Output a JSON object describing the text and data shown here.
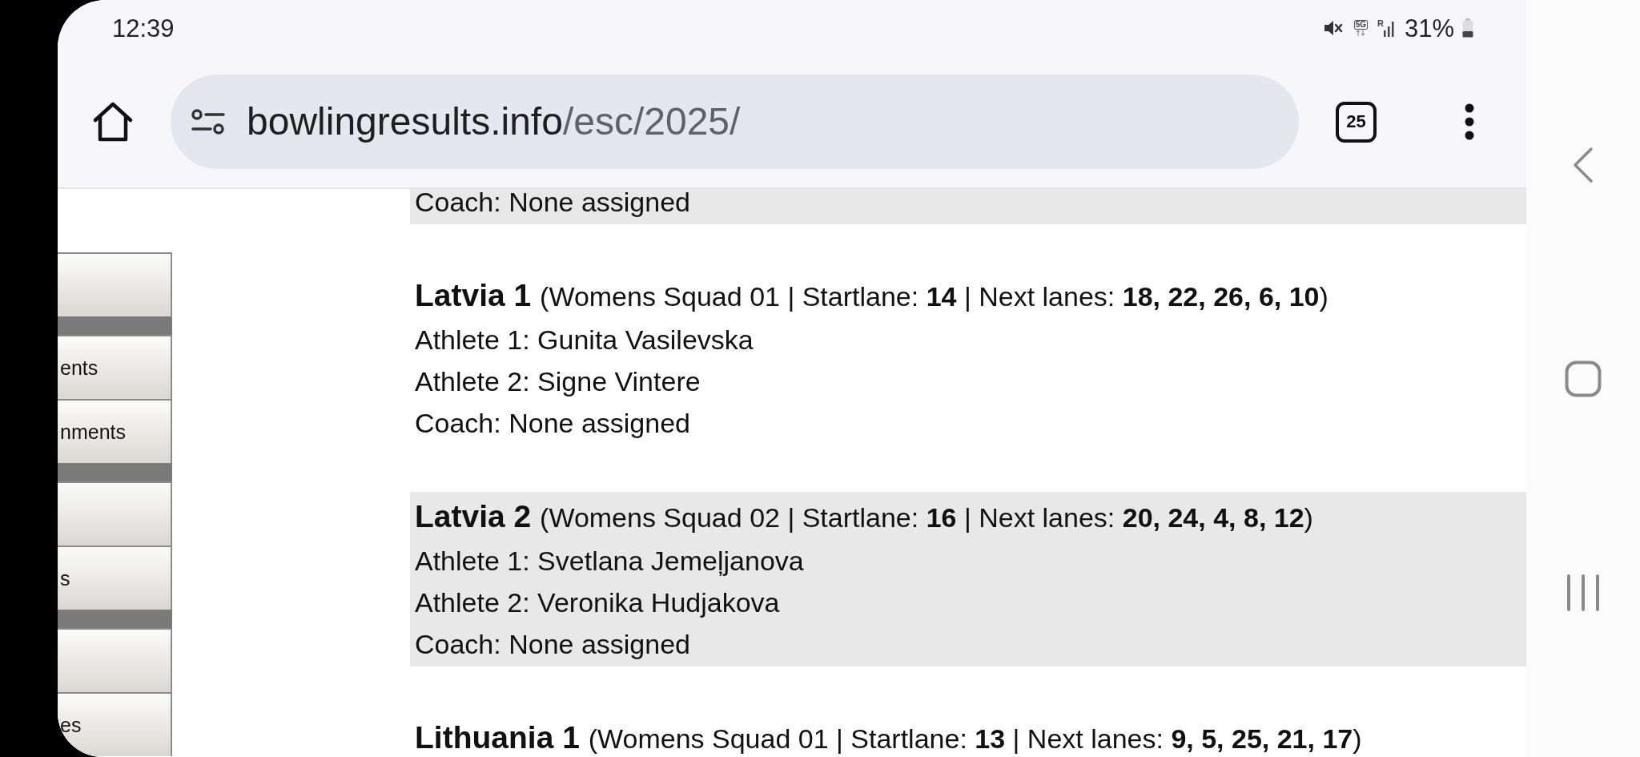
{
  "status_bar": {
    "time": "12:39",
    "network_type": "5G",
    "roaming": "R",
    "battery": "31%"
  },
  "browser": {
    "url_host": "bowlingresults.info",
    "url_path": "/esc/2025/",
    "tab_count": "25"
  },
  "sidebar": {
    "items": [
      {
        "kind": "button"
      },
      {
        "kind": "separator"
      },
      {
        "kind": "button",
        "label": "ents"
      },
      {
        "kind": "button",
        "label": "nments"
      },
      {
        "kind": "separator"
      },
      {
        "kind": "button"
      },
      {
        "kind": "button",
        "label": "s"
      },
      {
        "kind": "separator"
      },
      {
        "kind": "button"
      },
      {
        "kind": "button",
        "label": "es"
      }
    ]
  },
  "teams": [
    {
      "lines": [
        "Coach: None assigned"
      ]
    },
    {
      "name": "Latvia 1",
      "details": "(Womens Squad 01 | Startlane: **14** | Next lanes: **18, 22, 26, 6, 10**)",
      "lines": [
        "Athlete 1: Gunita Vasilevska",
        "Athlete 2: Signe Vintere",
        "Coach: None assigned"
      ]
    },
    {
      "name": "Latvia 2",
      "details": "(Womens Squad 02 | Startlane: **16** | Next lanes: **20, 24, 4, 8, 12**)",
      "lines": [
        "Athlete 1: Svetlana Jemeļjanova",
        "Athlete 2: Veronika Hudjakova",
        "Coach: None assigned"
      ]
    },
    {
      "name": "Lithuania 1",
      "details": "(Womens Squad 01 | Startlane: **13** | Next lanes: **9, 5, 25, 21, 17**)"
    }
  ]
}
